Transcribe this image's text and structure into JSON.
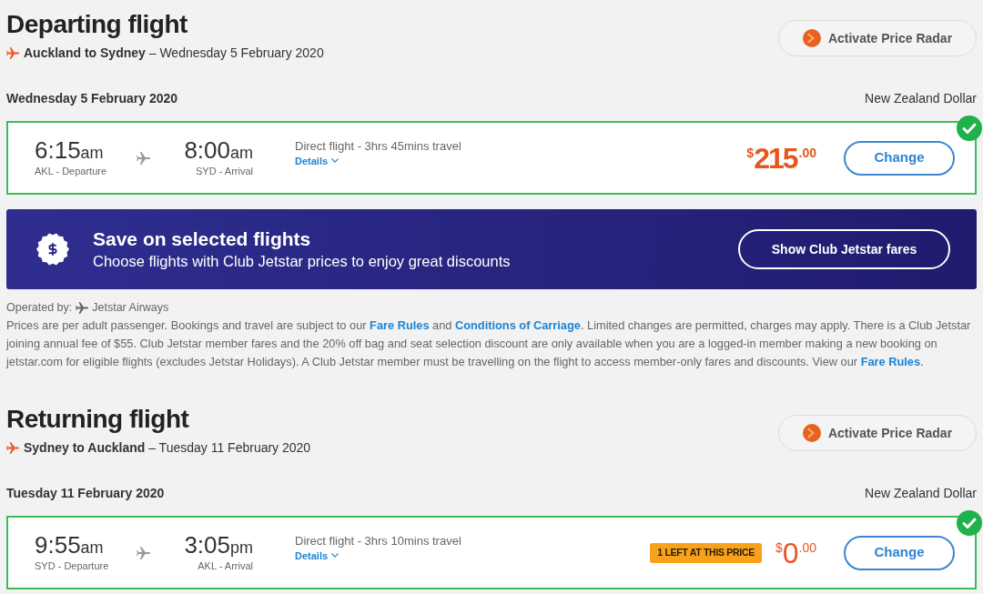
{
  "departing": {
    "title": "Departing flight",
    "route": "**Auckland to Sydney** – Wednesday 5 February 2020",
    "radar_button": "Activate Price Radar",
    "date": "Wednesday 5 February 2020",
    "currency": "New Zealand Dollar",
    "flight": {
      "selected": true,
      "departure": {
        "time": "6:15",
        "period": "am",
        "label": "AKL - Departure"
      },
      "arrival": {
        "time": "8:00",
        "period": "am",
        "label": "SYD - Arrival"
      },
      "info": "Direct flight - 3hrs 45mins travel",
      "details_link": "Details",
      "price": {
        "currency": "$",
        "amount": "215",
        "cents": ".00",
        "bold": true
      },
      "button": "Change"
    }
  },
  "promo": {
    "title": "Save on selected flights",
    "subtitle": "Choose flights with Club Jetstar prices to enjoy great discounts",
    "button": "Show Club Jetstar fares"
  },
  "operated_by": {
    "label": "Operated by:",
    "airline": "Jetstar Airways"
  },
  "fare_notice": [
    {
      "kind": "text",
      "text": "Prices are per adult passenger. Bookings and travel are subject to our "
    },
    {
      "kind": "link",
      "text": "Fare Rules"
    },
    {
      "kind": "text",
      "text": " and "
    },
    {
      "kind": "link",
      "text": "Conditions of Carriage"
    },
    {
      "kind": "text",
      "text": ". Limited changes are permitted, charges may apply. There is a Club Jetstar joining annual fee of $55. Club Jetstar member fares and the 20% off bag and seat selection discount are only available when you are a logged-in member making a new booking on jetstar.com for eligible flights (excludes Jetstar Holidays). A Club Jetstar member must be travelling on the flight to access member-only fares and discounts. View our "
    },
    {
      "kind": "link",
      "text": "Fare Rules"
    },
    {
      "kind": "text",
      "text": "."
    }
  ],
  "returning": {
    "title": "Returning flight",
    "route": "**Sydney to Auckland** – Tuesday 11 February 2020",
    "radar_button": "Activate Price Radar",
    "date": "Tuesday 11 February 2020",
    "currency": "New Zealand Dollar",
    "flight": {
      "selected": true,
      "departure": {
        "time": "9:55",
        "period": "am",
        "label": "SYD - Departure"
      },
      "arrival": {
        "time": "3:05",
        "period": "pm",
        "label": "AKL - Arrival"
      },
      "info": "Direct flight - 3hrs 10mins travel",
      "details_link": "Details",
      "badge": "1 LEFT AT THIS PRICE",
      "price": {
        "currency": "$",
        "amount": "0",
        "cents": ".00",
        "bold": false
      },
      "button": "Change"
    }
  }
}
